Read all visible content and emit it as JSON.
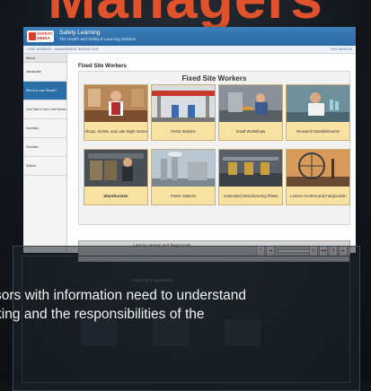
{
  "hero": {
    "title": "Managers"
  },
  "app": {
    "logo_text": "SAFETY MEDIA",
    "title": "Safety Learning",
    "subtitle": "The Health and Safety E Learning Solution",
    "breadcrumb": "LONE WORKING - MANAGEMENT INTERACTIVE",
    "exit_label": "EXIT MODULE"
  },
  "sidebar": {
    "header": "Menu",
    "items": [
      {
        "label": "Introduction",
        "active": false
      },
      {
        "label": "Who is A Lone Worker?",
        "active": true
      },
      {
        "label": "How Safe is Your Lone Worker?",
        "active": false
      },
      {
        "label": "Summary",
        "active": false
      },
      {
        "label": "Checklist",
        "active": false
      },
      {
        "label": "Sizified",
        "active": false
      }
    ]
  },
  "content": {
    "section_title": "Fixed Site Workers",
    "panel_title": "Fixed Site Workers",
    "tiles": [
      {
        "label": "Shops, Kiosks, and Late Night Stores",
        "icon": "shop-worker-photo"
      },
      {
        "label": "Petrol Stations",
        "icon": "petrol-station-photo"
      },
      {
        "label": "Small Workshops",
        "icon": "workshop-photo"
      },
      {
        "label": "Research Establishments",
        "icon": "lab-photo"
      },
      {
        "label": "Warehouses",
        "icon": "warehouse-photo"
      },
      {
        "label": "Power Stations",
        "icon": "power-station-photo"
      },
      {
        "label": "Automated Manufacturing Plants",
        "icon": "factory-photo"
      },
      {
        "label": "Leisure Centres and Fairgrounds",
        "icon": "fairground-photo"
      }
    ],
    "player_caption": "Leisure centres and fairgrounds",
    "controls": [
      "?",
      "◂",
      "↻",
      "◂◂",
      "II",
      "▸"
    ]
  },
  "lower": {
    "tiny_caption": "FIXED SITE WORKERS",
    "text_line1": "sors with information need to understand",
    "text_line2": "king and the responsibilities of the"
  },
  "colors": {
    "accent": "#e0522c",
    "header": "#2a6aa6",
    "tile_label": "#f8e2a2"
  }
}
